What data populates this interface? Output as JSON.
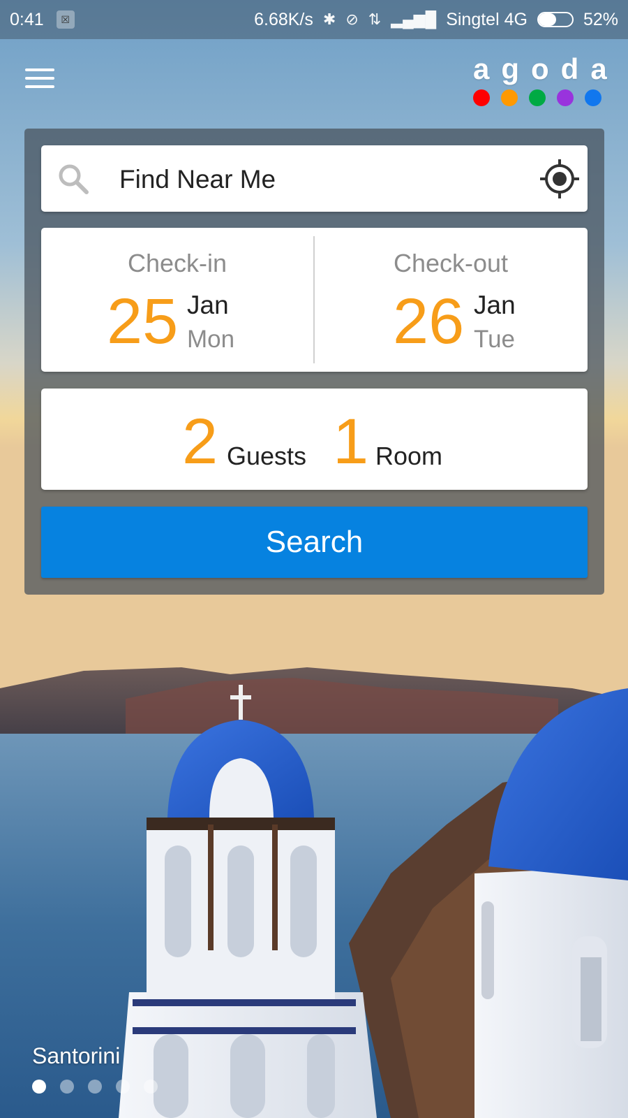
{
  "status_bar": {
    "time": "0:41",
    "network_speed": "6.68K/s",
    "carrier": "Singtel 4G",
    "battery": "52%",
    "battery_level": 0.52,
    "icons": [
      "notification-icon",
      "bluetooth-icon",
      "alarm-off-icon",
      "data-icon",
      "signal-icon",
      "battery-icon"
    ]
  },
  "header": {
    "menu_icon": "hamburger-menu-icon",
    "logo_text": "agoda",
    "logo_colors": [
      "#ff0000",
      "#ff9900",
      "#00aa44",
      "#9933dd",
      "#1177ee"
    ]
  },
  "search": {
    "value": "Find Near Me",
    "icon": "search-icon",
    "location_icon": "gps-target-icon"
  },
  "check_in": {
    "label": "Check-in",
    "day": "25",
    "month": "Jan",
    "weekday": "Mon"
  },
  "check_out": {
    "label": "Check-out",
    "day": "26",
    "month": "Jan",
    "weekday": "Tue"
  },
  "occupancy": {
    "guests_count": "2",
    "guests_label": "Guests",
    "rooms_count": "1",
    "rooms_label": "Room"
  },
  "search_button": "Search",
  "carousel": {
    "caption": "Santorini",
    "page_count": 5,
    "active_index": 0
  },
  "colors": {
    "accent_orange": "#f79d19",
    "primary_blue": "#0682e0"
  }
}
